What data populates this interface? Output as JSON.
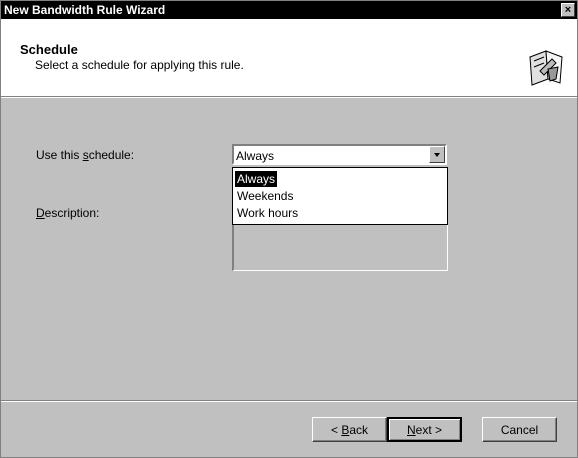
{
  "window": {
    "title": "New Bandwidth Rule Wizard",
    "close_glyph": "×"
  },
  "header": {
    "title": "Schedule",
    "subtitle": "Select a schedule for applying this rule.",
    "icon": "wizard-schedule-icon"
  },
  "form": {
    "schedule_label_pre": "Use this ",
    "schedule_label_key": "s",
    "schedule_label_post": "chedule:",
    "schedule_value": "Always",
    "schedule_options": [
      "Always",
      "Weekends",
      "Work hours"
    ],
    "selected_index": 0,
    "description_label_key": "D",
    "description_label_post": "escription:"
  },
  "buttons": {
    "back_pre": "< ",
    "back_key": "B",
    "back_post": "ack",
    "next_key": "N",
    "next_post": "ext >",
    "cancel": "Cancel"
  }
}
